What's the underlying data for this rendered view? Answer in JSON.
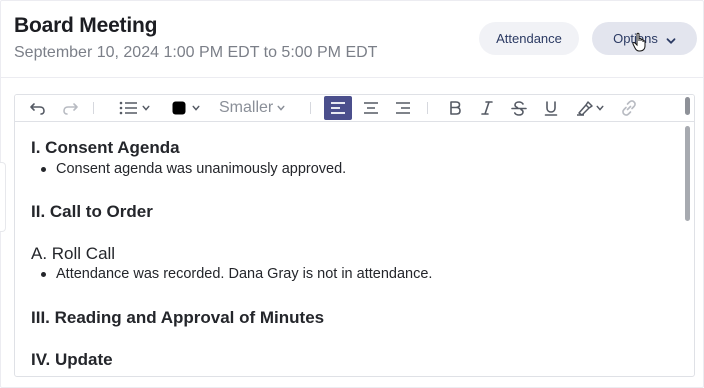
{
  "meeting": {
    "title": "Board Meeting",
    "datetime": "September 10, 2024 1:00 PM EDT to 5:00 PM EDT"
  },
  "actions": {
    "attendance_label": "Attendance",
    "options_label": "Options"
  },
  "toolbar": {
    "font_size_label": "Smaller",
    "text_color": "#000000",
    "active_align_color": "#4b4f8c"
  },
  "content": {
    "section1": {
      "heading": "I. Consent Agenda",
      "bullet": "Consent agenda was unanimously approved."
    },
    "section2": {
      "heading": "II. Call to Order"
    },
    "subsection_a": {
      "heading": "A. Roll Call",
      "bullet": "Attendance was recorded. Dana Gray is not in attendance."
    },
    "section3": {
      "heading": "III. Reading and Approval of Minutes"
    },
    "section4": {
      "heading": "IV. Update"
    }
  }
}
